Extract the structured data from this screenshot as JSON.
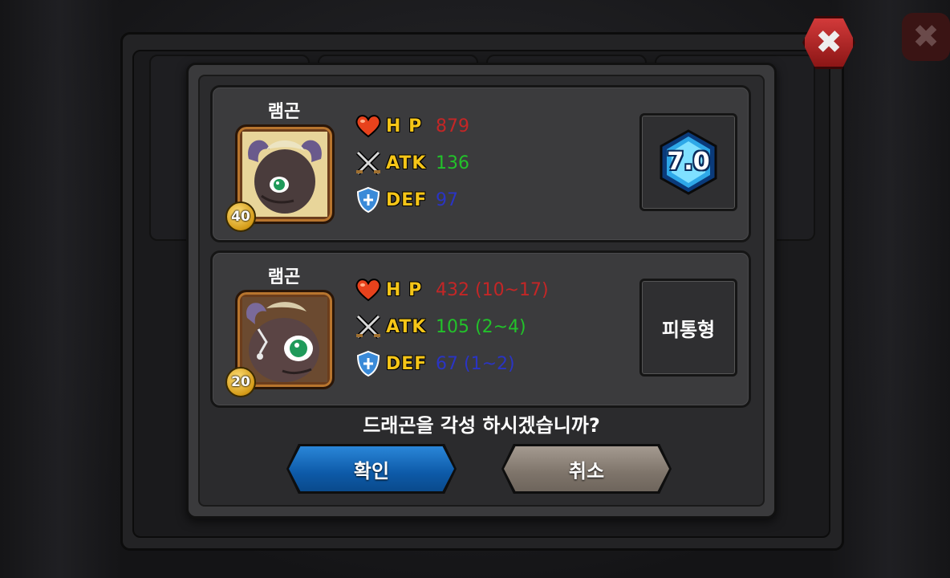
{
  "dialog": {
    "question": "드래곤을 각성 하시겠습니까?",
    "confirm_label": "확인",
    "cancel_label": "취소"
  },
  "cards": [
    {
      "name": "램곤",
      "level": "40",
      "hp_label": "H P",
      "atk_label": "ATK",
      "def_label": "DEF",
      "hp": "879",
      "atk": "136",
      "def": "97",
      "side_text": "7.0"
    },
    {
      "name": "램곤",
      "level": "20",
      "hp_label": "H P",
      "atk_label": "ATK",
      "def_label": "DEF",
      "hp": "432 (10~17)",
      "atk": "105 (2~4)",
      "def": "67 (1~2)",
      "side_text": "피통형"
    }
  ],
  "colors": {
    "hp": "#c42626",
    "atk": "#22c22a",
    "def": "#2a34c4",
    "label": "#f5c518",
    "confirm": "#1570c4",
    "cancel": "#8a8076"
  },
  "icons": {
    "hp": "heart-icon",
    "atk": "crossed-swords-icon",
    "def": "shield-icon",
    "grade": "hexagon-grade-icon",
    "close": "close-icon"
  }
}
